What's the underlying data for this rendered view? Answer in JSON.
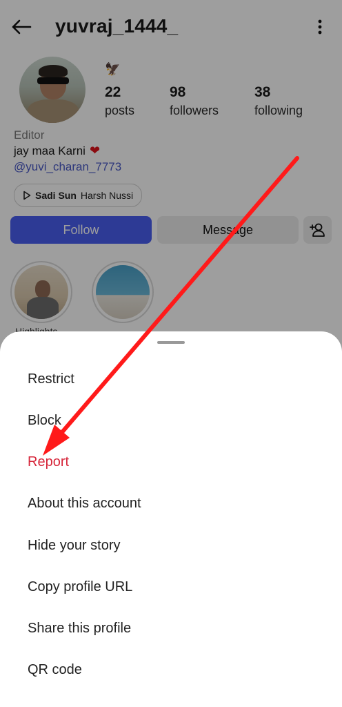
{
  "header": {
    "username": "yuvraj_1444_",
    "back_icon": "back-arrow-icon",
    "menu_icon": "more-vertical-icon"
  },
  "profile": {
    "emoji": "🦅",
    "stats": [
      {
        "value": "22",
        "label": "posts"
      },
      {
        "value": "98",
        "label": "followers"
      },
      {
        "value": "38",
        "label": "following"
      }
    ],
    "category": "Editor",
    "bio": "jay maa Karni",
    "bio_heart": "❤",
    "mention": "@yuvi_charan_7773",
    "music": {
      "song": "Sadi Sun",
      "artist": "Harsh Nussi"
    }
  },
  "actions": {
    "follow": "Follow",
    "message": "Message"
  },
  "highlights": {
    "label": "Highlights"
  },
  "sheet": {
    "items": [
      {
        "label": "Restrict"
      },
      {
        "label": "Block"
      },
      {
        "label": "Report"
      },
      {
        "label": "About this account"
      },
      {
        "label": "Hide your story"
      },
      {
        "label": "Copy profile URL"
      },
      {
        "label": "Share this profile"
      },
      {
        "label": "QR code"
      }
    ]
  },
  "colors": {
    "follow_button": "#4a5ef0",
    "report_text": "#d6263a",
    "annotation_arrow": "#ff1a1a",
    "mention": "#4a5ac7"
  }
}
